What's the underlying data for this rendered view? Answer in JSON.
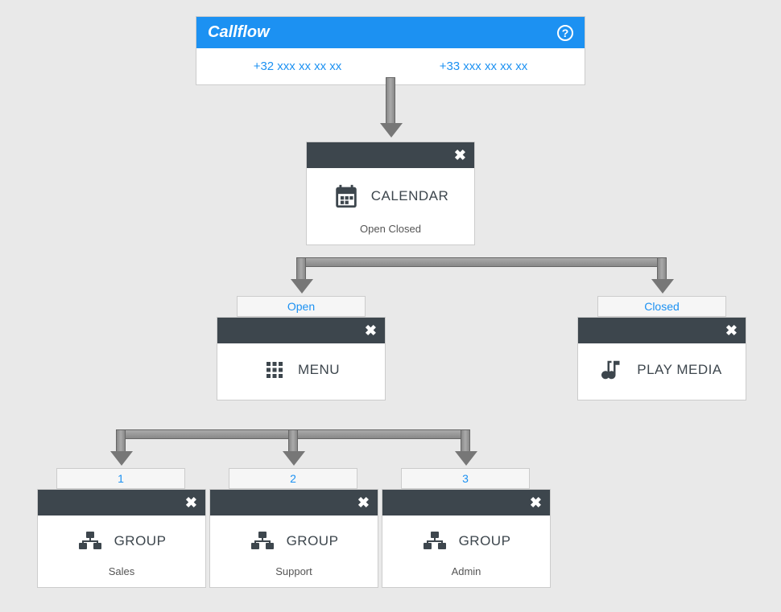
{
  "root": {
    "title": "Callflow",
    "help": "?",
    "numbers": [
      "+32 xxx xx xx xx",
      "+33 xxx xx xx xx"
    ]
  },
  "calendar": {
    "close": "✖",
    "title": "CALENDAR",
    "sub": "Open Closed"
  },
  "branch_open": {
    "label": "Open"
  },
  "branch_closed": {
    "label": "Closed"
  },
  "menu": {
    "close": "✖",
    "title": "MENU"
  },
  "playmedia": {
    "close": "✖",
    "title": "PLAY MEDIA"
  },
  "option1": {
    "label": "1"
  },
  "option2": {
    "label": "2"
  },
  "option3": {
    "label": "3"
  },
  "group1": {
    "close": "✖",
    "title": "GROUP",
    "sub": "Sales"
  },
  "group2": {
    "close": "✖",
    "title": "GROUP",
    "sub": "Support"
  },
  "group3": {
    "close": "✖",
    "title": "GROUP",
    "sub": "Admin"
  }
}
